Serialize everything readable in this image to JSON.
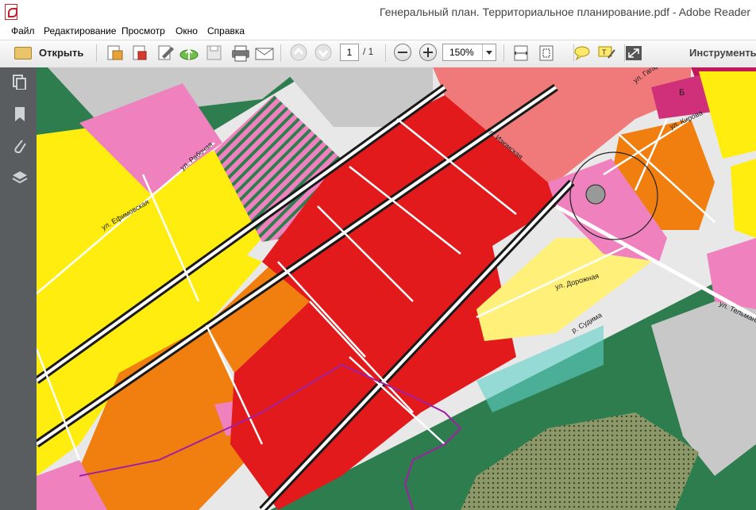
{
  "window": {
    "title": "Генеральный план. Территориальное планирование.pdf - Adobe Reader"
  },
  "menu": [
    "Файл",
    "Редактирование",
    "Просмотр",
    "Окно",
    "Справка"
  ],
  "toolbar": {
    "open_label": "Открыть",
    "page_current": "1",
    "page_total": "/ 1",
    "zoom": "150%",
    "tools_label": "Инструменты"
  },
  "sidebar": {
    "icons": [
      "pages-icon",
      "bookmark-icon",
      "attachment-icon",
      "layers-icon"
    ]
  },
  "map": {
    "streets": [
      "ул. Ефимовская",
      "ул. Рабочая",
      "ул. Изюмская",
      "ул. Кирова",
      "ул. Дорожная",
      "ул. Тельмана",
      "р. Судима",
      "ул. Гагарина"
    ],
    "label_b": "Б"
  },
  "colors": {
    "red_zone": "#e31a1c",
    "orange_zone": "#f07f0f",
    "yellow_zone": "#ffed0f",
    "pink_zone": "#ef82be",
    "green_zone": "#2e7d4f",
    "gray_zone": "#c8c8c8",
    "salmon_zone": "#f07a7a",
    "light_yellow_zone": "#fff07a"
  }
}
